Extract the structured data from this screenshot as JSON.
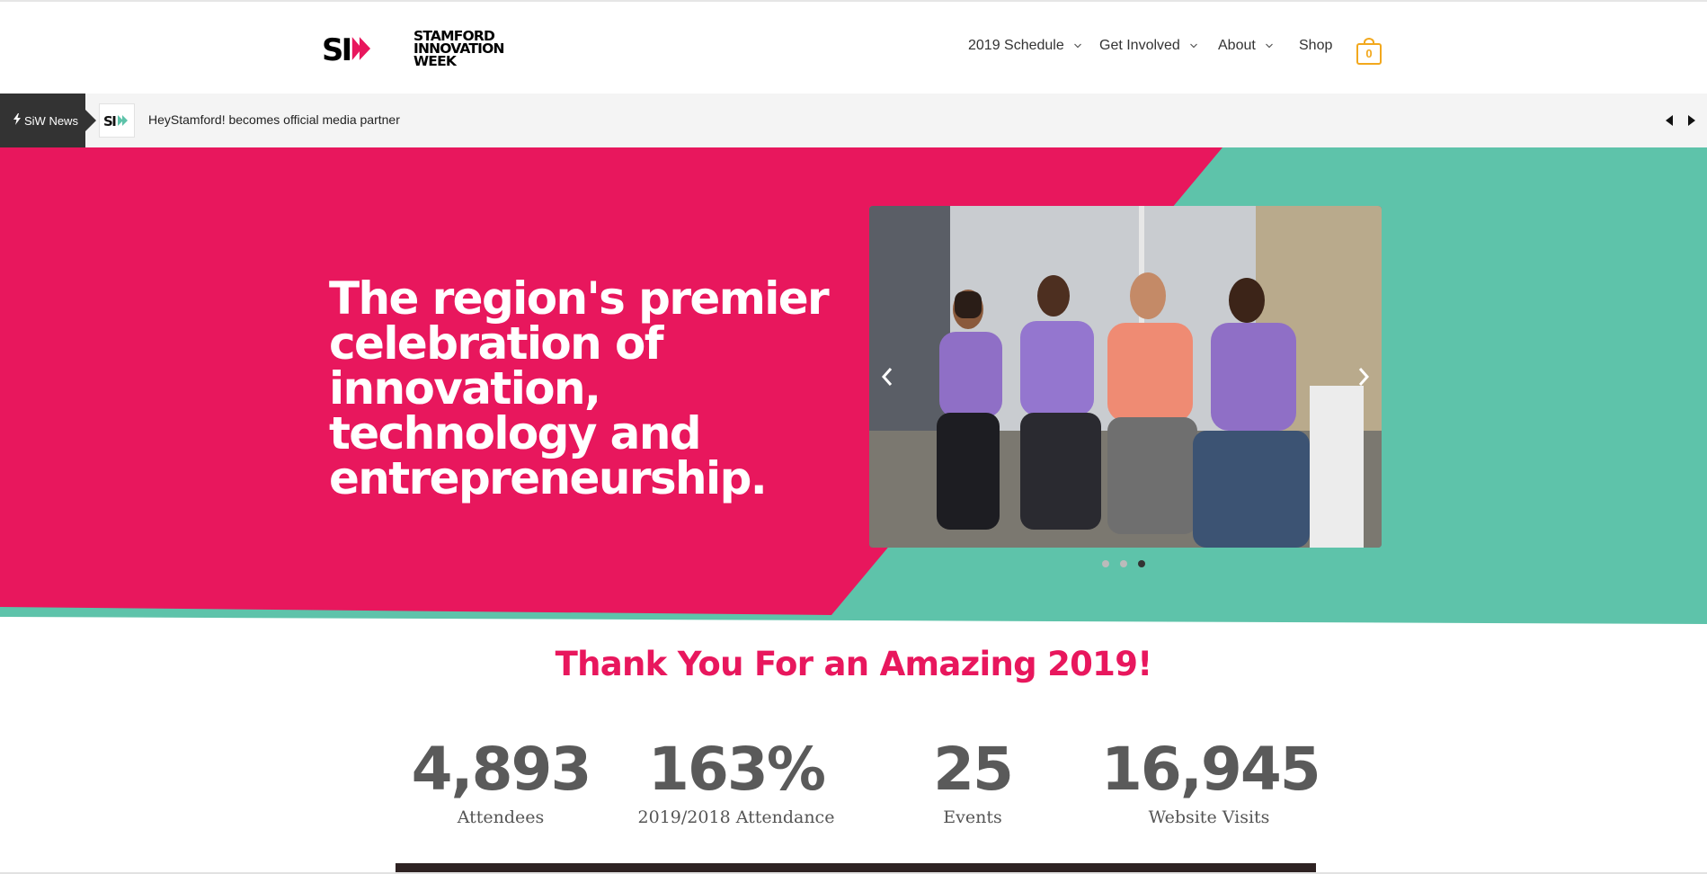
{
  "header": {
    "logo_lines": [
      "STAMFORD",
      "INNOVATION",
      "WEEK"
    ],
    "logo_mark_text": "SI",
    "nav": [
      {
        "label": "2019 Schedule",
        "has_dropdown": true
      },
      {
        "label": "Get Involved",
        "has_dropdown": true
      },
      {
        "label": "About",
        "has_dropdown": true
      },
      {
        "label": "Shop",
        "has_dropdown": false
      }
    ],
    "cart_count": "0",
    "cart_icon": "shopping-bag-icon"
  },
  "ticker": {
    "label": "SiW News",
    "label_icon": "lightning-icon",
    "headline": "HeyStamford! becomes official media partner",
    "prev_icon": "triangle-left-icon",
    "next_icon": "triangle-right-icon"
  },
  "hero": {
    "title": "The region's premier celebration of innovation, technology and entrepreneurship.",
    "slider": {
      "slide_count": 3,
      "active_slide": 3,
      "prev_icon": "chevron-left-icon",
      "next_icon": "chevron-right-icon"
    }
  },
  "stats": {
    "heading": "Thank You For an Amazing 2019!",
    "items": [
      {
        "value": "4,893",
        "label": "Attendees"
      },
      {
        "value": "163%",
        "label": "2019/2018 Attendance"
      },
      {
        "value": "25",
        "label": "Events"
      },
      {
        "value": "16,945",
        "label": "Website Visits"
      }
    ]
  },
  "colors": {
    "brand_pink": "#e8175d",
    "brand_teal": "#5ec3aa",
    "cart_accent": "#f2a81d",
    "stat_text": "#5a5a5a"
  }
}
